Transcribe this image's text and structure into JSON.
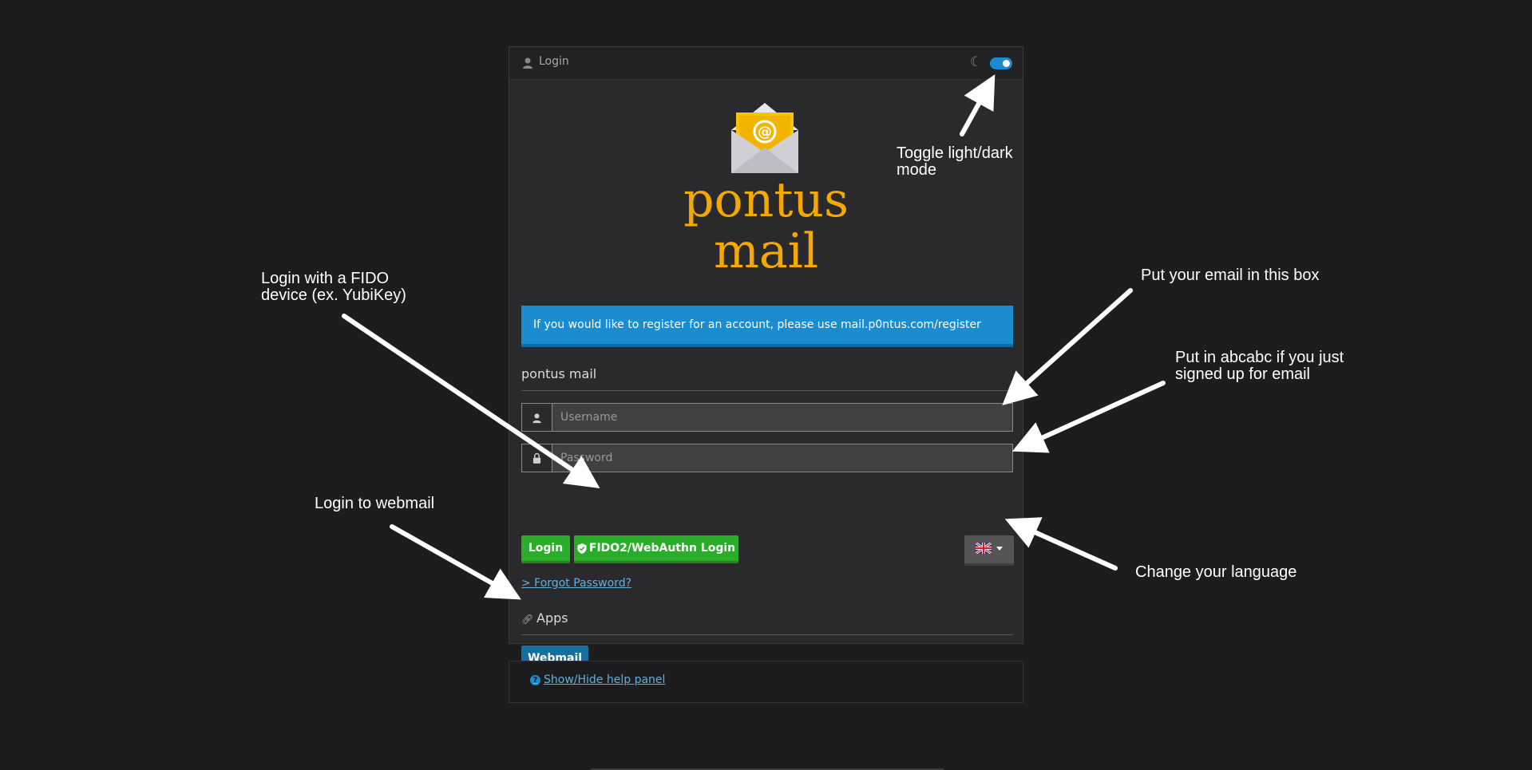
{
  "header": {
    "title": "Login",
    "user_icon": "user-icon",
    "dark_mode_icon": "moon-icon",
    "dark_mode_on": true
  },
  "logo": {
    "icon": "envelope-at-icon",
    "line1": "pontus",
    "line2": "mail",
    "color": "#f5a800"
  },
  "info_banner": {
    "text": "If you would like to register for an account, please use mail.p0ntus.com/register"
  },
  "form": {
    "section_title": "pontus mail",
    "username_placeholder": "Username",
    "password_placeholder": "Password",
    "login_label": "Login",
    "fido_label": "FIDO2/WebAuthn Login",
    "language_flag": "uk-flag-icon",
    "forgot_label": "> Forgot Password?"
  },
  "apps": {
    "title": "Apps",
    "webmail_label": "Webmail"
  },
  "help": {
    "label": "Show/Hide help panel"
  },
  "annotations": {
    "toggle": "Toggle light/dark mode",
    "fido": "Login with a FIDO device (ex. YubiKey)",
    "email": "Put your email in this box",
    "password": "Put in abcabc if you just signed up for email",
    "webmail": "Login to webmail",
    "language": "Change your language"
  },
  "colors": {
    "accent": "#1a8ccf",
    "success": "#2aae2a",
    "brand": "#f5a800",
    "background": "#1d1d1f"
  }
}
